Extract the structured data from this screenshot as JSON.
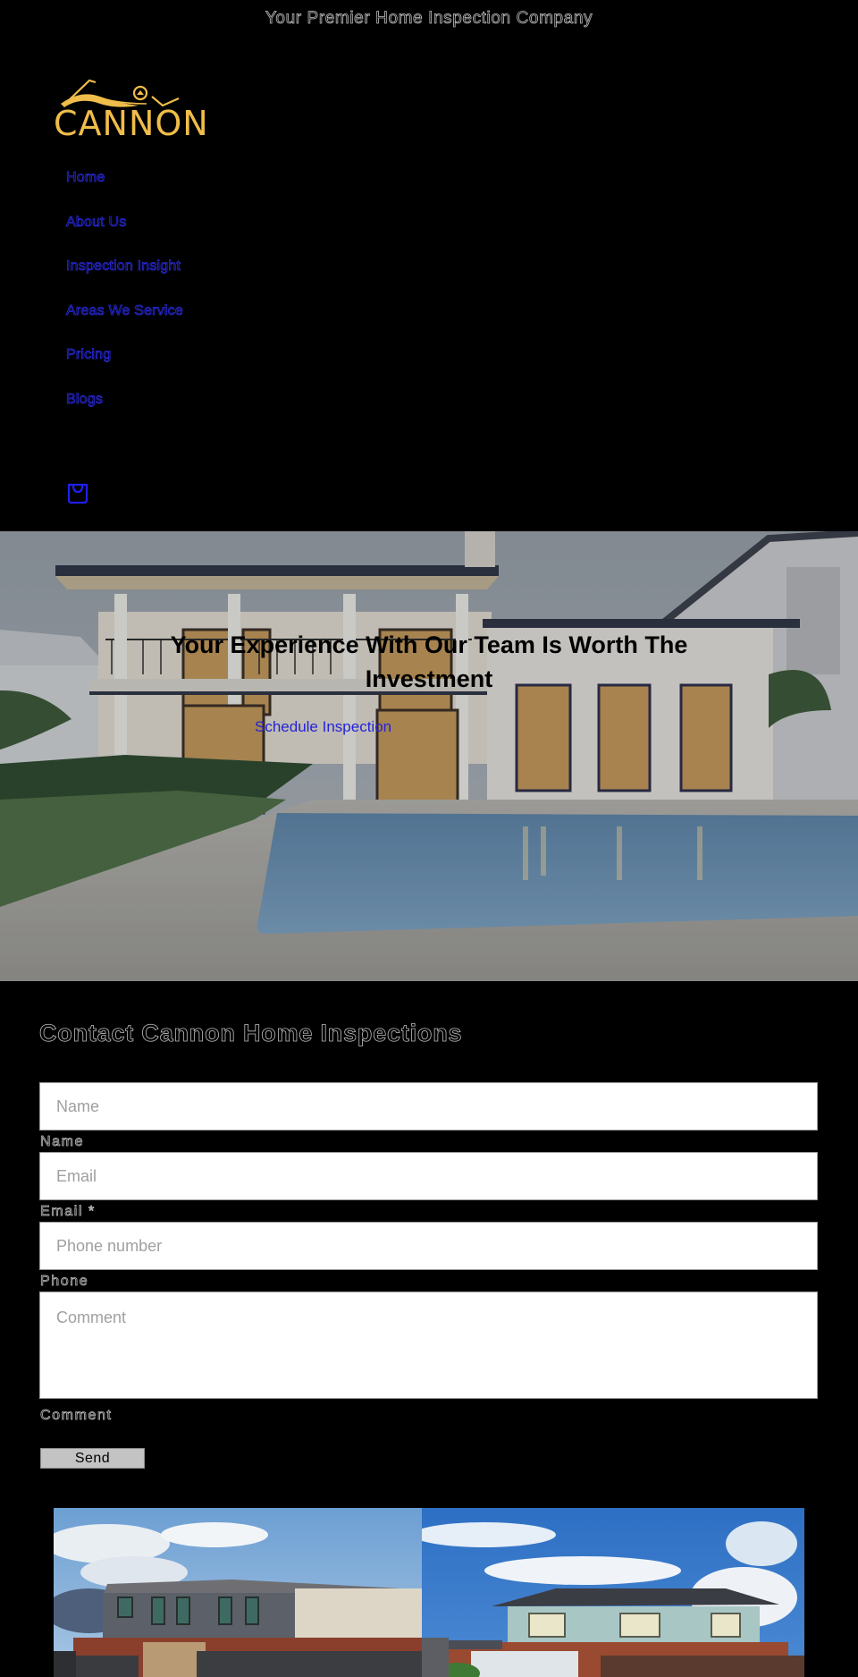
{
  "announcement": "Your Premier Home Inspection Company",
  "brand": {
    "name": "CANNON",
    "logo_color": "#f0bd4a"
  },
  "nav": {
    "items": [
      {
        "label": "Home"
      },
      {
        "label": "About Us"
      },
      {
        "label": "Inspection Insight"
      },
      {
        "label": "Areas We Service"
      },
      {
        "label": "Pricing"
      },
      {
        "label": "Blogs"
      }
    ],
    "cart_icon": "shopping-bag-icon",
    "link_color": "#2b2be6"
  },
  "hero": {
    "title": "Your Experience With Our Team Is Worth The Investment",
    "cta_label": "Schedule Inspection"
  },
  "contact": {
    "title": "Contact Cannon Home Inspections",
    "fields": {
      "name": {
        "placeholder": "Name",
        "label": "Name",
        "value": ""
      },
      "email": {
        "placeholder": "Email",
        "label": "Email *",
        "value": ""
      },
      "phone": {
        "placeholder": "Phone number",
        "label": "Phone",
        "value": ""
      },
      "comment": {
        "placeholder": "Comment",
        "label": "Comment",
        "value": ""
      }
    },
    "submit_label": "Send"
  },
  "gallery": {
    "images": [
      {
        "alt": "Modern two-storey grey and cream house"
      },
      {
        "alt": "Two-storey light blue weatherboard house with brick base"
      }
    ]
  }
}
